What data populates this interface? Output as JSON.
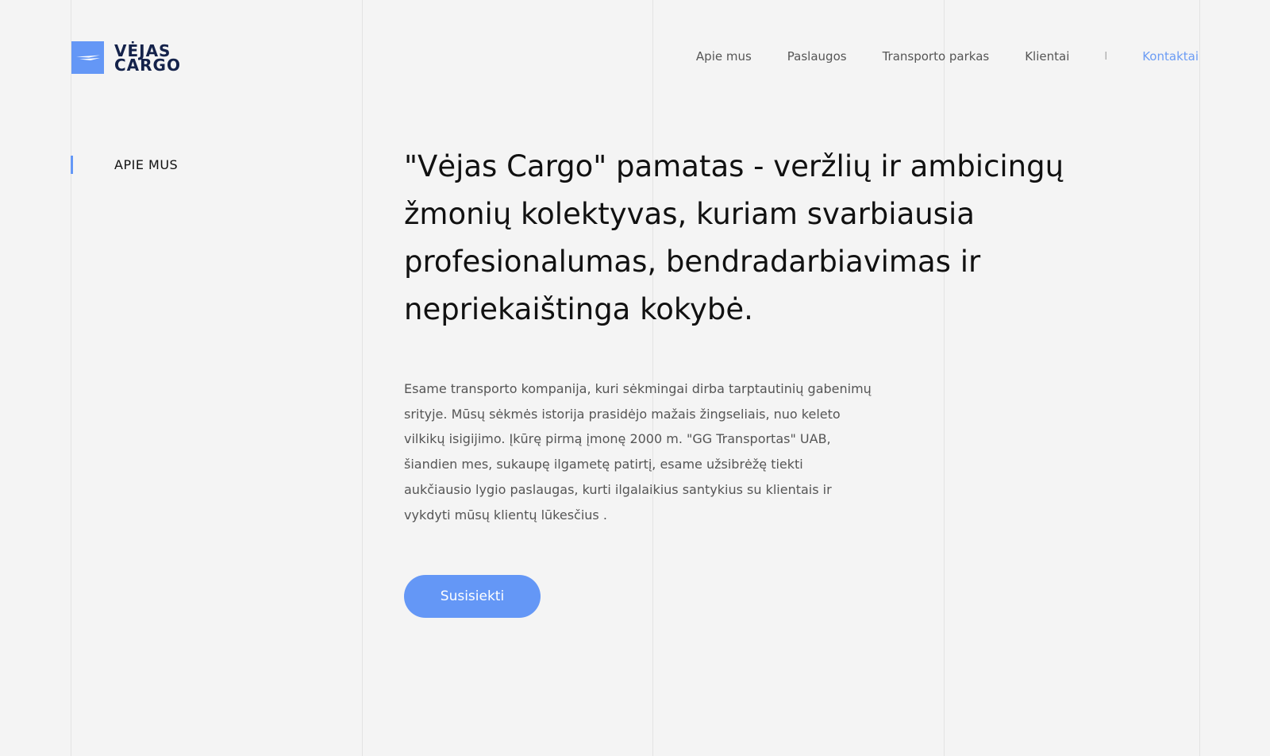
{
  "brand": {
    "line1": "VĖJAS",
    "line2": "CARGO",
    "accent_color": "#6497f6",
    "text_color": "#14224a"
  },
  "nav": {
    "items": [
      "Apie mus",
      "Paslaugos",
      "Transporto parkas",
      "Klientai"
    ],
    "separator": "I",
    "contact": "Kontaktai",
    "contact_color": "#6b9cf4"
  },
  "sidebar": {
    "section_label": "APIE MUS"
  },
  "main": {
    "headline": "\"Vėjas Cargo\" pamatas - veržlių ir ambicingų žmonių kolektyvas, kuriam svarbiausia profesionalumas, bendradarbiavimas ir nepriekaištinga kokybė.",
    "body": "Esame transporto kompanija, kuri sėkmingai dirba tarptautinių gabenimų srityje. Mūsų sėkmės istorija prasidėjo mažais žingseliais, nuo keleto vilkikų isigijimo. Įkūrę pirmą įmonę 2000 m. \"GG Transportas\" UAB,  šiandien mes, sukaupę ilgametę patirtį, esame užsibrėžę tiekti aukčiausio lygio paslaugas, kurti ilgalaikius santykius su klientais ir vykdyti mūsų klientų lūkesčius .",
    "cta_label": "Susisiekti"
  }
}
